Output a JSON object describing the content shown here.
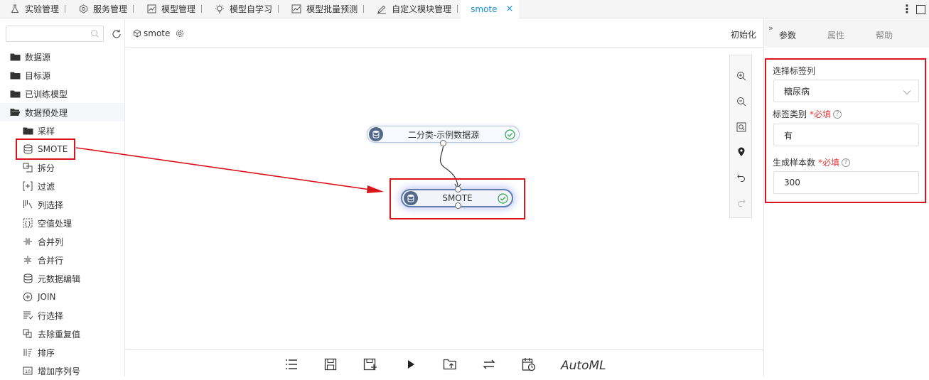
{
  "tabs": [
    {
      "label": "实验管理",
      "icon": "flask-icon"
    },
    {
      "label": "服务管理",
      "icon": "service-icon"
    },
    {
      "label": "模型管理",
      "icon": "chart-icon"
    },
    {
      "label": "模型自学习",
      "icon": "bulb-icon"
    },
    {
      "label": "模型批量预测",
      "icon": "trend-icon"
    },
    {
      "label": "自定义模块管理",
      "icon": "pen-icon"
    },
    {
      "label": "smote",
      "icon": "",
      "active": true
    }
  ],
  "close_symbol": "×",
  "search": {
    "placeholder": "",
    "value": ""
  },
  "tree": {
    "datasource": "数据源",
    "target": "目标源",
    "trained": "已训练模型",
    "preprocess": "数据预处理",
    "children": [
      "采样",
      "SMOTE",
      "拆分",
      "过滤",
      "列选择",
      "空值处理",
      "合并列",
      "合并行",
      "元数据编辑",
      "JOIN",
      "行选择",
      "去除重复值",
      "排序",
      "增加序列号"
    ]
  },
  "canvas": {
    "flow_name": "smote",
    "init_label": "初始化",
    "nodes": [
      {
        "label": "二分类-示例数据源"
      },
      {
        "label": "SMOTE"
      }
    ]
  },
  "bottom": {
    "automl": "AutoML"
  },
  "right": {
    "tabs": [
      "参数",
      "属性",
      "帮助"
    ],
    "fields": [
      {
        "label": "选择标签列",
        "value": "糖尿病",
        "required": ""
      },
      {
        "label": "标签类别",
        "required": "*必填",
        "value": "有"
      },
      {
        "label": "生成样本数",
        "required": "*必填",
        "value": "300"
      }
    ]
  },
  "colors": {
    "accent": "#1b8fd6",
    "annotation": "#d9141d",
    "node_icon": "#55698a",
    "ok_green": "#2ea84a"
  }
}
